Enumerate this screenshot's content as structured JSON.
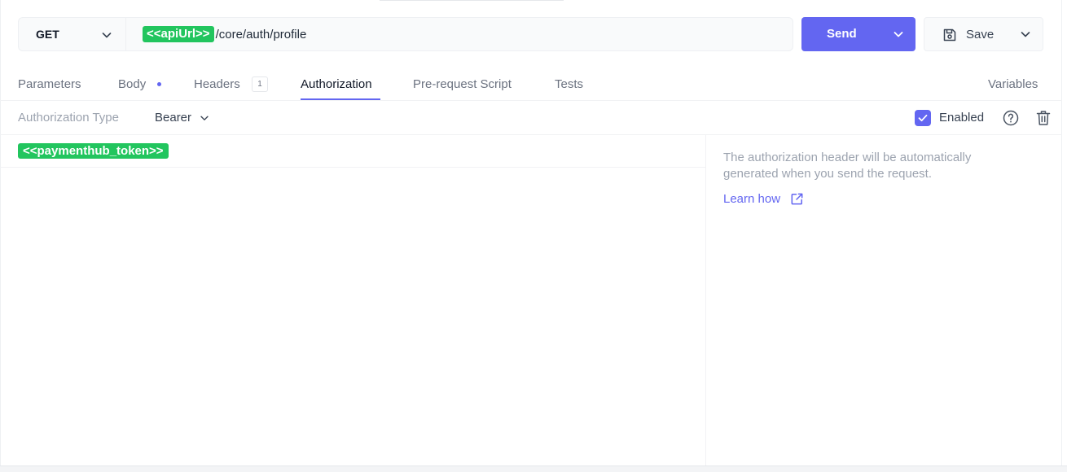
{
  "request": {
    "method": "GET",
    "url_variable": "<<apiUrl>>",
    "url_path": "/core/auth/profile",
    "send_label": "Send",
    "save_label": "Save"
  },
  "tabs": [
    {
      "label": "Parameters",
      "active": false
    },
    {
      "label": "Body",
      "active": false
    },
    {
      "label": "Headers",
      "active": false,
      "count": "1"
    },
    {
      "label": "Authorization",
      "active": true
    },
    {
      "label": "Pre-request Script",
      "active": false
    },
    {
      "label": "Tests",
      "active": false
    }
  ],
  "variables_label": "Variables",
  "auth": {
    "type_label": "Authorization Type",
    "type_value": "Bearer",
    "enabled_label": "Enabled",
    "enabled": true,
    "token": "<<paymenthub_token>>"
  },
  "info": {
    "text": "The authorization header will be automatically generated when you send the request.",
    "link_label": "Learn how"
  },
  "icons": {
    "method_dropdown": "chevron-down-icon",
    "send_dropdown": "chevron-down-icon",
    "save": "save-icon",
    "help": "help-circle-icon",
    "delete": "trash-icon",
    "external_link": "external-link-icon",
    "checkbox": "check-icon"
  },
  "colors": {
    "accent": "#6366f1",
    "variable_chip": "#22c55e"
  }
}
